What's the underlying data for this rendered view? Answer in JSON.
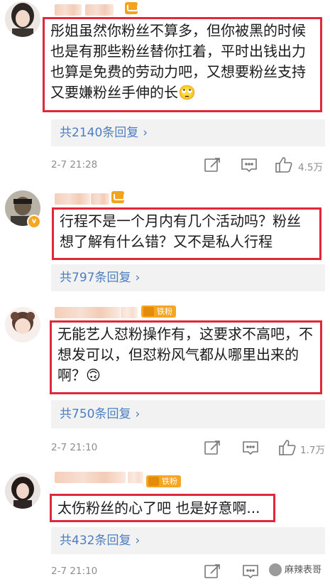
{
  "comments": [
    {
      "text": "彤姐虽然你粉丝不算多，但你被黑的时候也是有那些粉丝替你扛着，平时出钱出力也算是免费的劳动力吧，又想要粉丝支持又要嫌粉丝手伸的长🙄",
      "replies_label": "共2140条回复",
      "time": "2-7 21:28",
      "likes": "4.5万"
    },
    {
      "text": "行程不是一个月内有几个活动吗？粉丝想了解有什么错？又不是私人行程",
      "replies_label": "共797条回复",
      "time": "",
      "likes": ""
    },
    {
      "text": "无能艺人怼粉操作有，这要求不高吧，不想发可以，但怼粉风气都从哪里出来的啊？🙃",
      "badge": "铁粉",
      "replies_label": "共750条回复",
      "time": "2-7 21:10",
      "likes": "1.7万"
    },
    {
      "text": "太伤粉丝的心了吧 也是好意啊...",
      "badge": "铁粉",
      "replies_label": "共432条回复",
      "time": "2-7 21:10",
      "likes": ""
    }
  ],
  "chevron": "›",
  "watermark": "麻辣表哥",
  "colors": {
    "highlight": "#e0283c",
    "link": "#4b7ec0",
    "meta": "#8e8e8e",
    "reply_bg": "#f2f2f2"
  }
}
